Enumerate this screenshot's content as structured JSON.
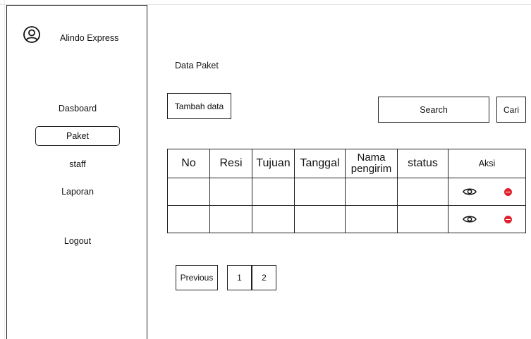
{
  "app": {
    "brand": "Alindo Express"
  },
  "sidebar": {
    "items": [
      {
        "label": "Dasboard",
        "active": false
      },
      {
        "label": "Paket",
        "active": true
      },
      {
        "label": "staff",
        "active": false
      },
      {
        "label": "Laporan",
        "active": false
      },
      {
        "label": "Logout",
        "active": false
      }
    ]
  },
  "main": {
    "title": "Data Paket",
    "add_button": "Tambah data",
    "search": {
      "label": "Search"
    },
    "search_button": "Cari",
    "table": {
      "headers": [
        "No",
        "Resi",
        "Tujuan",
        "Tanggal",
        "Nama pengirim",
        "status",
        "Aksi"
      ],
      "rows": [
        {
          "cells": [
            "",
            "",
            "",
            "",
            "",
            ""
          ],
          "actions": [
            "eye-icon",
            "remove-icon"
          ]
        },
        {
          "cells": [
            "",
            "",
            "",
            "",
            "",
            ""
          ],
          "actions": [
            "eye-icon",
            "remove-icon"
          ]
        }
      ]
    },
    "pagination": {
      "previous": "Previous",
      "pages": [
        "1",
        "2"
      ]
    }
  },
  "colors": {
    "border": "#222222",
    "delete": "#e0202a"
  }
}
